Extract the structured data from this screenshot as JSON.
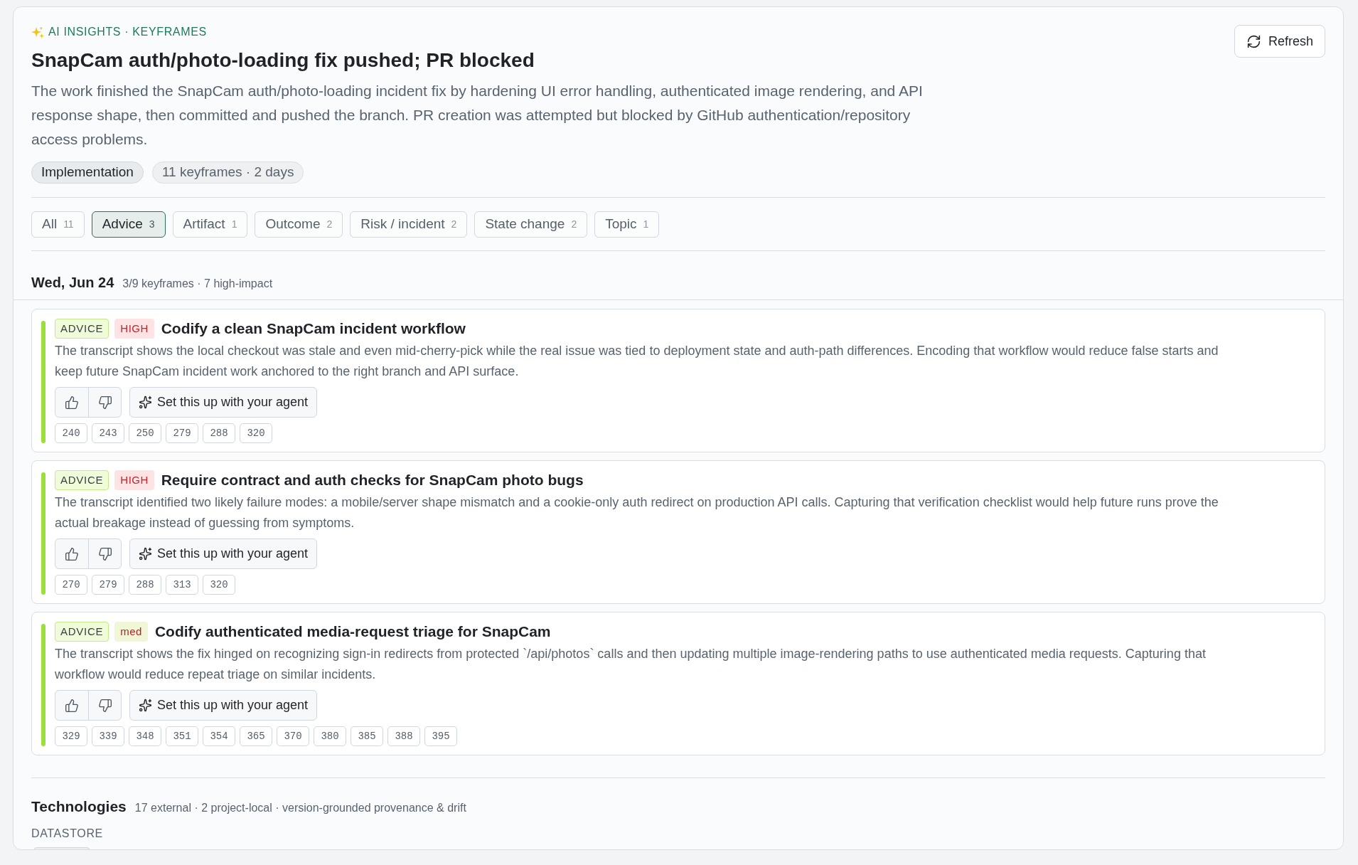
{
  "header": {
    "eyebrow": "AI INSIGHTS · KEYFRAMES",
    "title": "SnapCam auth/photo-loading fix pushed; PR blocked",
    "summary": "The work finished the SnapCam auth/photo-loading incident fix by hardening UI error handling, authenticated image rendering, and API response shape, then committed and pushed the branch. PR creation was attempted but blocked by GitHub authentication/repository access problems.",
    "tags": [
      {
        "label": "Implementation",
        "kind": "category"
      },
      {
        "label": "11 keyframes · 2 days",
        "kind": "meta"
      }
    ],
    "refresh_button": "Refresh"
  },
  "filters": [
    {
      "label": "All",
      "count": "11",
      "selected": false
    },
    {
      "label": "Advice",
      "count": "3",
      "selected": true
    },
    {
      "label": "Artifact",
      "count": "1",
      "selected": false
    },
    {
      "label": "Outcome",
      "count": "2",
      "selected": false
    },
    {
      "label": "Risk / incident",
      "count": "2",
      "selected": false
    },
    {
      "label": "State change",
      "count": "2",
      "selected": false
    },
    {
      "label": "Topic",
      "count": "1",
      "selected": false
    }
  ],
  "day": {
    "date": "Wed, Jun 24",
    "summary": "3/9 keyframes · 7 high-impact"
  },
  "insights": [
    {
      "type": "ADVICE",
      "impact": {
        "label": "HIGH",
        "kind": "high"
      },
      "title": "Codify a clean SnapCam incident workflow",
      "body": "The transcript shows the local checkout was stale and even mid-cherry-pick while the real issue was tied to deployment state and auth-path differences. Encoding that workflow would reduce false starts and keep future SnapCam incident work anchored to the right branch and API surface.",
      "agent_button": "Set this up with your agent",
      "keyframes": [
        "240",
        "243",
        "250",
        "279",
        "288",
        "320"
      ]
    },
    {
      "type": "ADVICE",
      "impact": {
        "label": "HIGH",
        "kind": "high"
      },
      "title": "Require contract and auth checks for SnapCam photo bugs",
      "body": "The transcript identified two likely failure modes: a mobile/server shape mismatch and a cookie-only auth redirect on production API calls. Capturing that verification checklist would help future runs prove the actual breakage instead of guessing from symptoms.",
      "agent_button": "Set this up with your agent",
      "keyframes": [
        "270",
        "279",
        "288",
        "313",
        "320"
      ]
    },
    {
      "type": "ADVICE",
      "impact": {
        "label": "med",
        "kind": "med"
      },
      "title": "Codify authenticated media-request triage for SnapCam",
      "body": "The transcript shows the fix hinged on recognizing sign-in redirects from protected `/api/photos` calls and then updating multiple image-rendering paths to use authenticated media requests. Capturing that workflow would reduce repeat triage on similar incidents.",
      "agent_button": "Set this up with your agent",
      "keyframes": [
        "329",
        "339",
        "348",
        "351",
        "354",
        "365",
        "370",
        "380",
        "385",
        "388",
        "395"
      ]
    }
  ],
  "technologies": {
    "title": "Technologies",
    "summary": "17 external · 2 project-local · version-grounded provenance & drift",
    "group": "DATASTORE"
  }
}
